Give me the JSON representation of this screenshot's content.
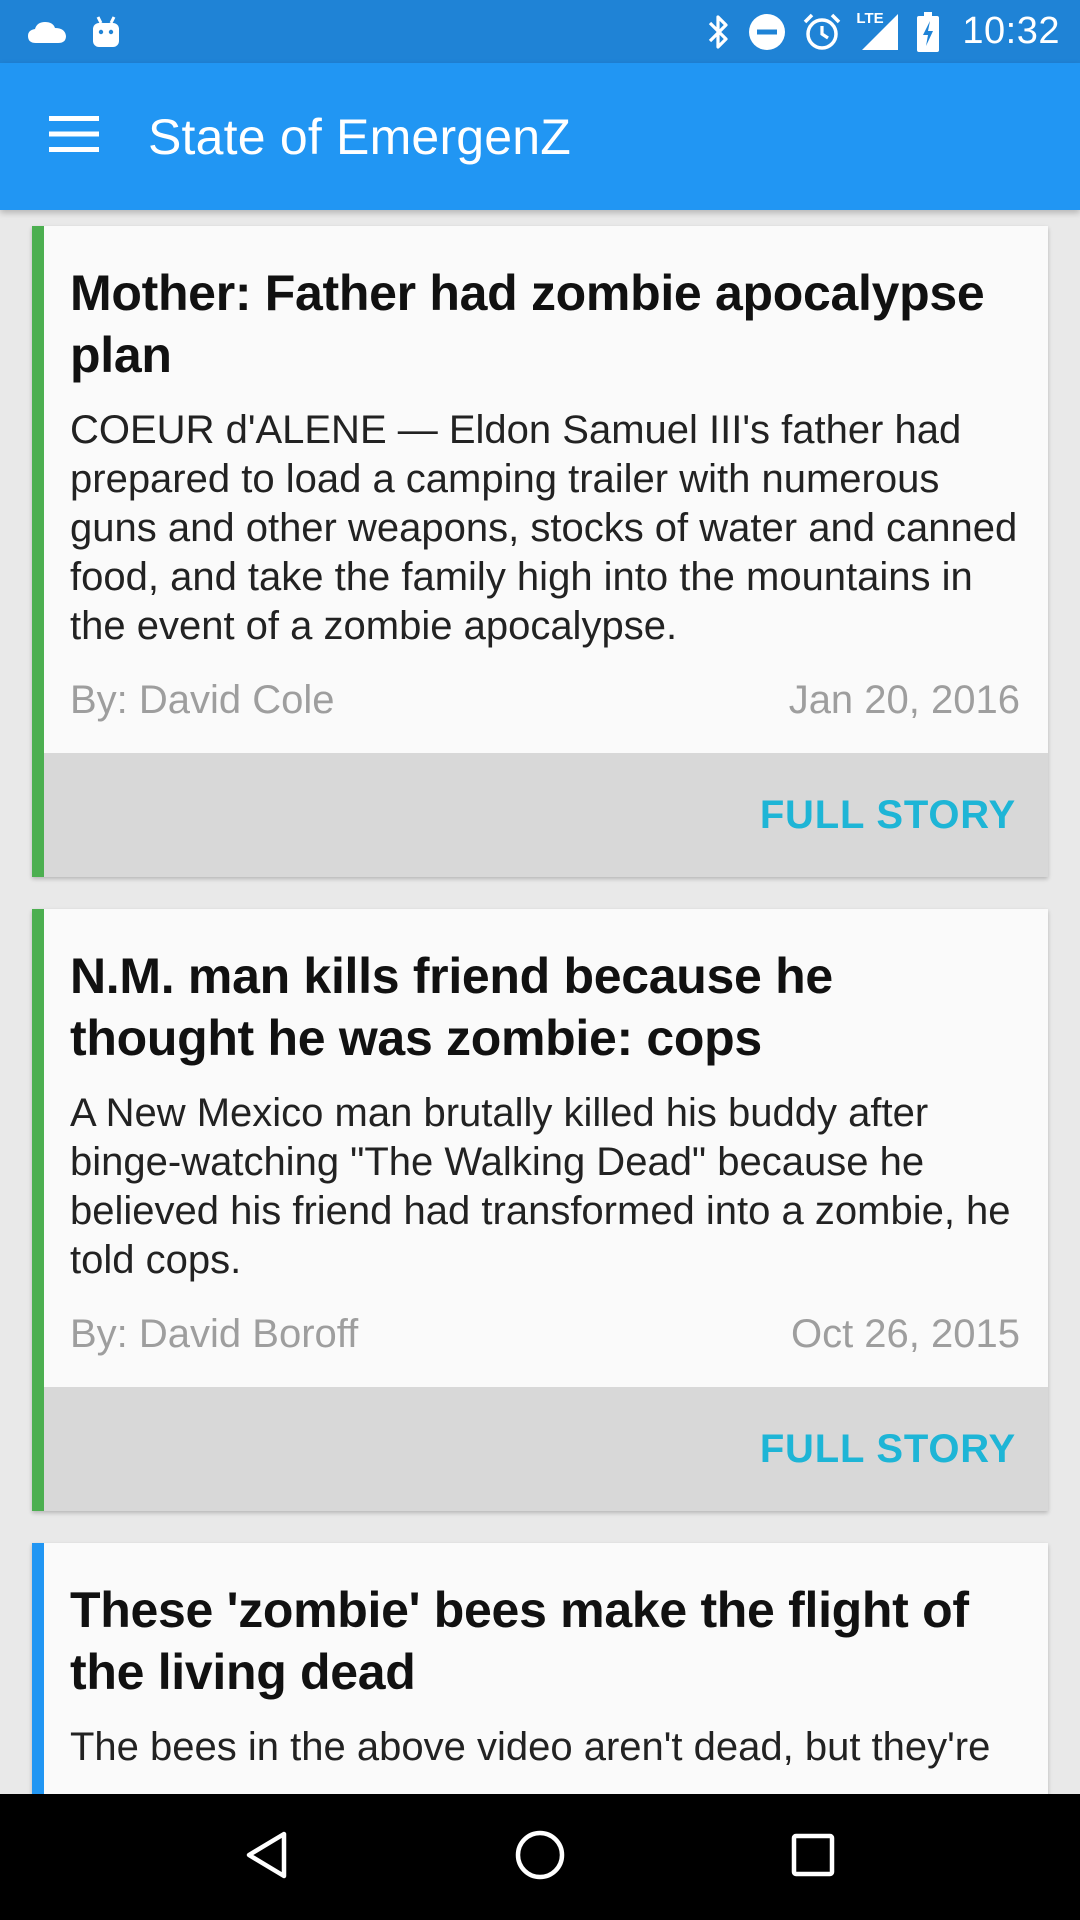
{
  "status_bar": {
    "time": "10:32",
    "left_icons": [
      "cloud-icon",
      "android-icon"
    ],
    "right_icons": [
      "bluetooth-icon",
      "do-not-disturb-icon",
      "alarm-icon",
      "lte-signal-icon",
      "battery-charging-icon"
    ],
    "lte_label": "LTE"
  },
  "app_bar": {
    "title": "State of EmergenZ",
    "menu_icon": "hamburger-menu-icon",
    "color": "#2196f3"
  },
  "articles": [
    {
      "title": "Mother: Father had zombie apocalypse plan",
      "summary": "COEUR d'ALENE — Eldon Samuel III's father had prepared to load a camping trailer with numerous guns and other weapons, stocks of water and canned food, and take the family high into the mountains in the event of a zombie apocalypse.",
      "author": "By: David Cole",
      "date": "Jan 20, 2016",
      "action": "FULL STORY",
      "accent_color": "#4caf50"
    },
    {
      "title": "N.M. man kills friend because he thought he was zombie: cops",
      "summary": "A New Mexico man brutally killed his buddy after binge-watching \"The Walking Dead\" because he believed his friend had transformed into a zombie, he told cops.",
      "author": "By: David Boroff",
      "date": "Oct 26, 2015",
      "action": "FULL STORY",
      "accent_color": "#4caf50"
    },
    {
      "title": "These 'zombie' bees make the flight of the living dead",
      "summary": "The bees in the above video aren't dead, but they're",
      "accent_color": "#2196f3"
    }
  ],
  "nav_bar": {
    "back_icon": "back-triangle-icon",
    "home_icon": "home-circle-icon",
    "recents_icon": "recents-square-icon"
  },
  "colors": {
    "status_bar": "#1f83d6",
    "action_text": "#1eb5d6",
    "footer_bg": "#d8d8d8",
    "background": "#e9e9e9"
  }
}
